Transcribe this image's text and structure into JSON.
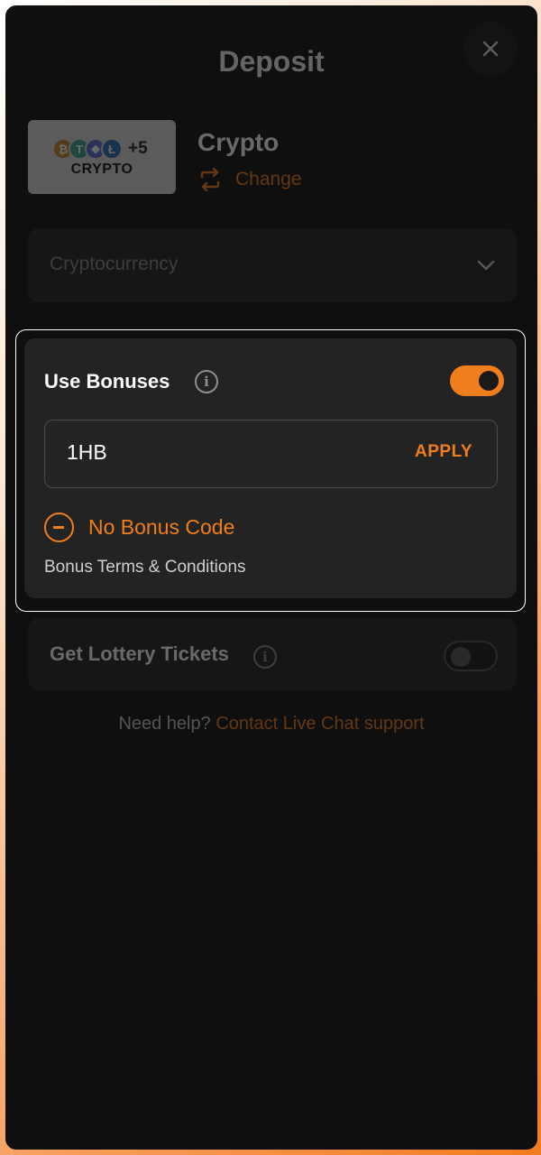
{
  "header": {
    "title": "Deposit",
    "close_icon": "close-icon"
  },
  "method": {
    "thumb_label": "CRYPTO",
    "coins": [
      {
        "glyph": "₿",
        "color": "#c8872f"
      },
      {
        "glyph": "T",
        "color": "#3aa38c"
      },
      {
        "glyph": "◆",
        "color": "#5a6bd8"
      },
      {
        "glyph": "Ł",
        "color": "#2d6fb5"
      }
    ],
    "coins_more": "+5",
    "name": "Crypto",
    "change_label": "Change"
  },
  "currency_select": {
    "placeholder": "Cryptocurrency"
  },
  "bonuses": {
    "title": "Use Bonuses",
    "toggle_on": true,
    "code_value": "1HB",
    "apply_label": "APPLY",
    "no_bonus_label": "No Bonus Code",
    "terms_label": "Bonus Terms & Conditions"
  },
  "lottery": {
    "title": "Get Lottery Tickets",
    "toggle_on": false
  },
  "help": {
    "prefix": "Need help? ",
    "link": "Contact Live Chat support"
  },
  "colors": {
    "accent": "#f07e1c",
    "background": "#0f0f0f",
    "card": "#232323"
  }
}
